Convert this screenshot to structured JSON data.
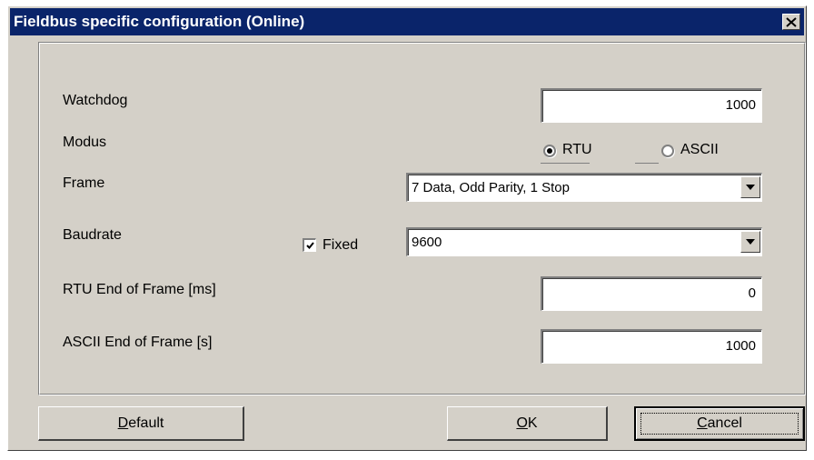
{
  "dialog": {
    "title": "Fieldbus specific configuration (Online)",
    "close_glyph": "✕"
  },
  "form": {
    "watchdog": {
      "label": "Watchdog",
      "value": "1000"
    },
    "modus": {
      "label": "Modus",
      "options": [
        {
          "label": "RTU",
          "selected": true
        },
        {
          "label": "ASCII",
          "selected": false
        }
      ]
    },
    "frame": {
      "label": "Frame",
      "selected": "7 Data, Odd  Parity, 1 Stop"
    },
    "baudrate": {
      "label": "Baudrate",
      "fixed_label": "Fixed",
      "fixed_checked": true,
      "selected": "9600"
    },
    "rtu_eof": {
      "label": "RTU End of Frame [ms]",
      "value": "0"
    },
    "ascii_eof": {
      "label": "ASCII End of Frame [s]",
      "value": "1000"
    }
  },
  "buttons": {
    "default": {
      "mnemonic": "D",
      "rest": "efault"
    },
    "ok": {
      "mnemonic": "O",
      "rest": "K"
    },
    "cancel": {
      "mnemonic": "C",
      "rest": "ancel"
    }
  },
  "icons": {
    "close": "close-icon",
    "dropdown": "chevron-down-icon",
    "check": "checkmark-icon"
  },
  "colors": {
    "titlebar": "#0a246a",
    "face": "#d4d0c8"
  }
}
